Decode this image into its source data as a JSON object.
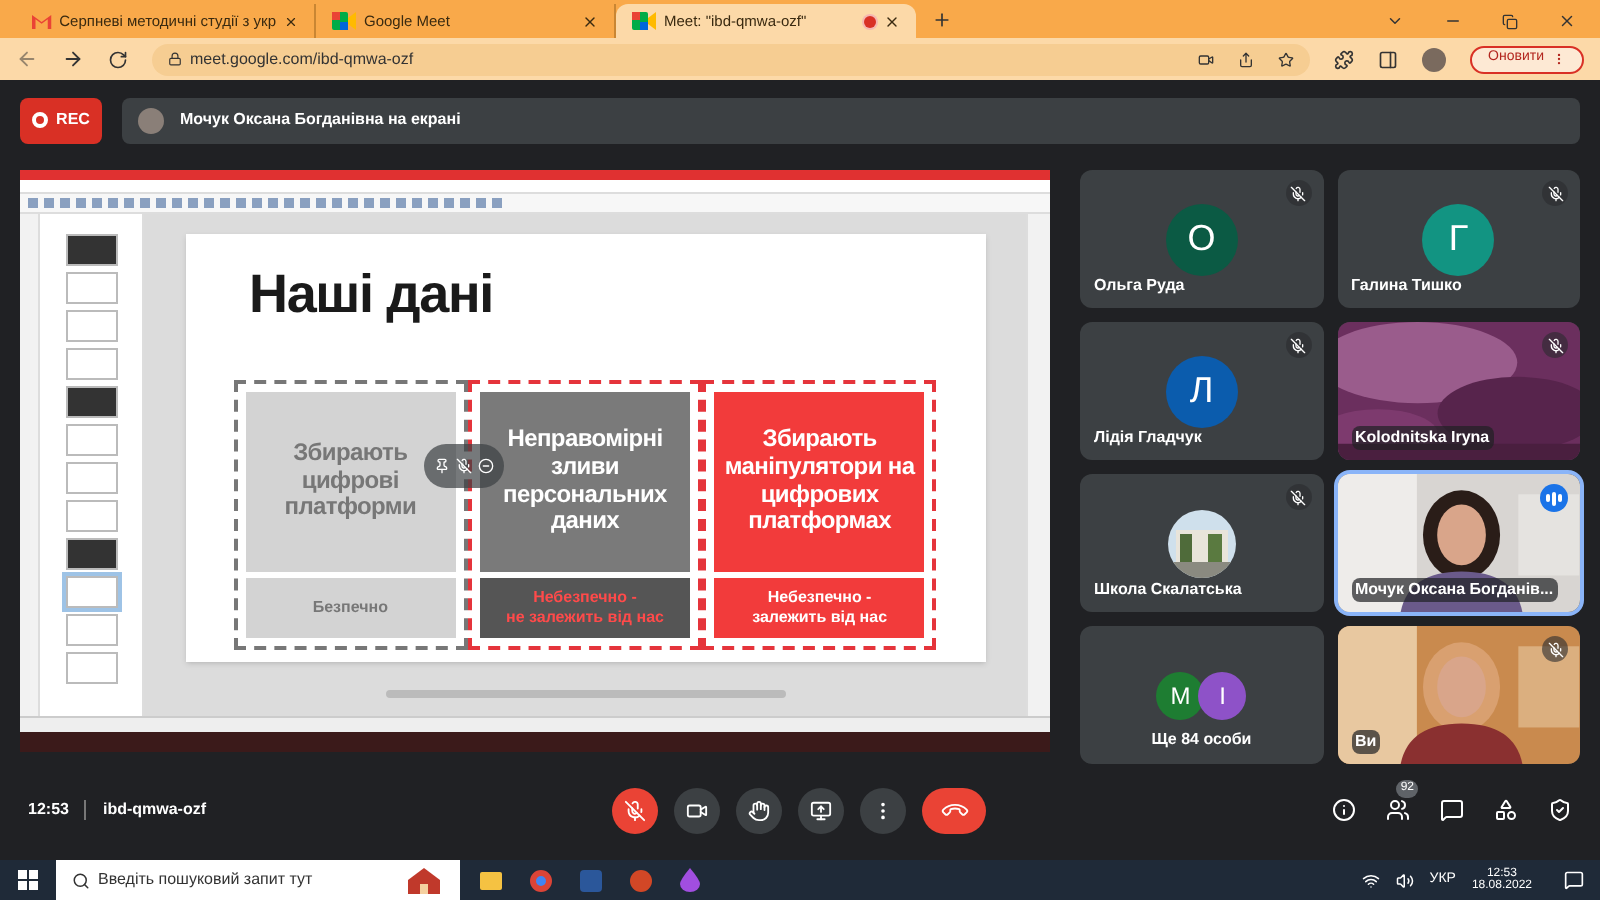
{
  "browser": {
    "tabs": [
      {
        "title": "Серпневі методичні студії з укр",
        "kind": "mail",
        "selected": false
      },
      {
        "title": "Google Meet",
        "kind": "meet",
        "selected": false
      },
      {
        "title": "Meet: \"ibd-qmwa-ozf\"",
        "kind": "meet",
        "selected": true,
        "recording": true
      }
    ],
    "address": "meet.google.com/ibd-qmwa-ozf",
    "update_button": "Оновити"
  },
  "meet": {
    "rec_label": "REC",
    "presenter_banner": "Мочук Оксана Богданівна на екрані",
    "slide": {
      "title": "Наші дані",
      "columns": [
        {
          "kind": "safe",
          "main": [
            "Збирають",
            "цифрові",
            "платформи"
          ],
          "footer": [
            "Безпечно"
          ]
        },
        {
          "kind": "dark",
          "main": [
            "Неправомірні",
            "зливи",
            "персональних",
            "даних"
          ],
          "footer": [
            "Небезпечно -",
            "не залежить від нас"
          ]
        },
        {
          "kind": "red",
          "main": [
            "Збирають",
            "маніпулятори на",
            "цифрових",
            "платформах"
          ],
          "footer": [
            "Небезпечно -",
            "залежить від нас"
          ]
        }
      ]
    },
    "tiles": [
      {
        "kind": "avatar",
        "name": "Ольга Руда",
        "letter": "О",
        "color": "#0b5a44",
        "muted": true,
        "speaking": false
      },
      {
        "kind": "avatar",
        "name": "Галина Тишко",
        "letter": "Г",
        "color": "#129482",
        "muted": true,
        "speaking": false
      },
      {
        "kind": "avatar",
        "name": "Лідія Гладчук",
        "letter": "Л",
        "color": "#0b5cad",
        "muted": true,
        "speaking": false
      },
      {
        "kind": "video",
        "name": "Kolodnitska Iryna",
        "muted": true,
        "speaking": false
      },
      {
        "name": "Школа Скалатська",
        "muted": true,
        "speaking": false
      },
      {
        "kind": "person",
        "name": "Мочук Оксана Богданів...",
        "muted": false,
        "speaking": true
      },
      {
        "kind": "more",
        "name": "Ще 84 особи",
        "avatars": [
          {
            "letter": "M",
            "color": "#1e7d32"
          },
          {
            "letter": "I",
            "color": "#8e52c8"
          }
        ],
        "muted": false,
        "speaking": false
      },
      {
        "kind": "person2",
        "name": "Ви",
        "muted": true,
        "speaking": false
      }
    ],
    "time": "12:53",
    "meeting_code": "ibd-qmwa-ozf",
    "people_count": "92"
  },
  "taskbar": {
    "search_placeholder": "Введіть пошуковий запит тут",
    "language": "УКР",
    "time": "12:53",
    "date": "18.08.2022"
  }
}
